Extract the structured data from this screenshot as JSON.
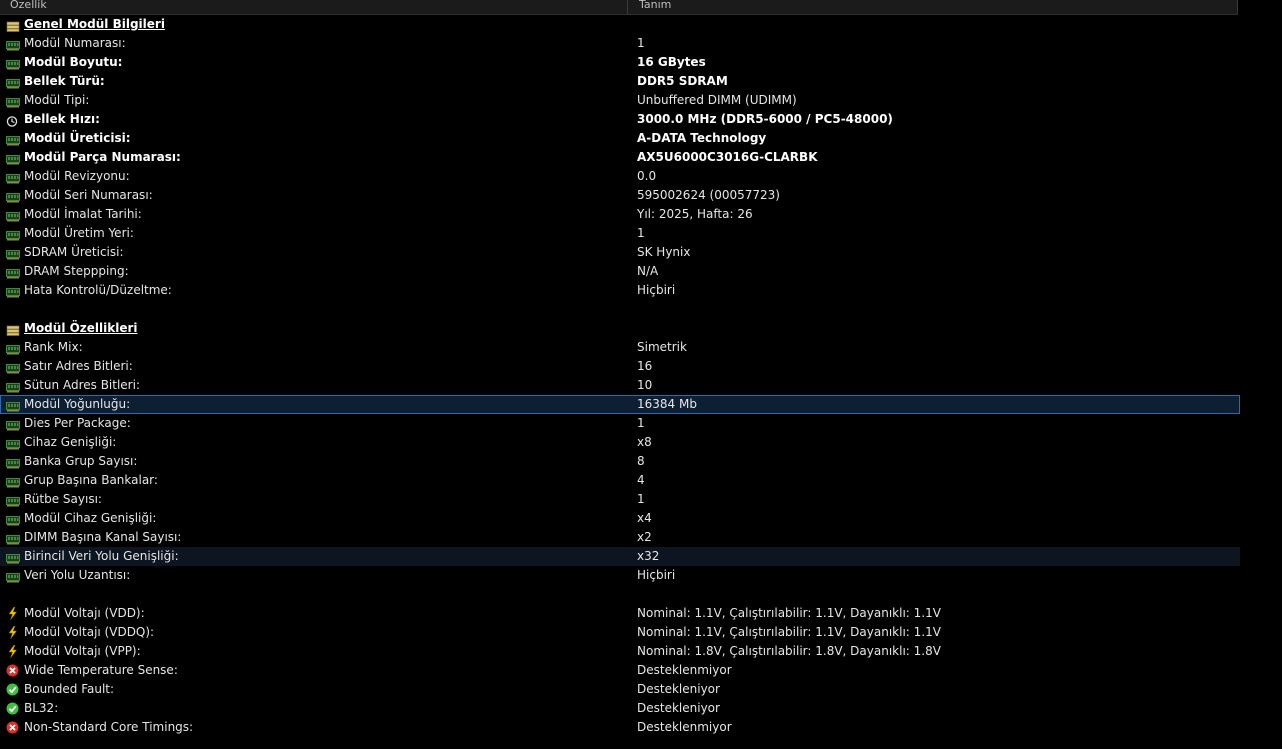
{
  "header": {
    "col_property": "Özellik",
    "col_value": "Tanım"
  },
  "rows": [
    {
      "type": "section",
      "icon": "memory-section-icon",
      "property": "Genel Modül Bilgileri",
      "value": ""
    },
    {
      "type": "item",
      "icon": "ram-module-icon",
      "property": "Modül Numarası:",
      "value": "1"
    },
    {
      "type": "item",
      "icon": "ram-module-icon",
      "property": "Modül Boyutu:",
      "value": "16 GBytes",
      "bold": true
    },
    {
      "type": "item",
      "icon": "ram-module-icon",
      "property": "Bellek Türü:",
      "value": "DDR5 SDRAM",
      "bold": true
    },
    {
      "type": "item",
      "icon": "ram-module-icon",
      "property": "Modül Tipi:",
      "value": "Unbuffered DIMM (UDIMM)"
    },
    {
      "type": "item",
      "icon": "clock-icon",
      "property": "Bellek Hızı:",
      "value": "3000.0 MHz (DDR5-6000 / PC5-48000)",
      "bold": true
    },
    {
      "type": "item",
      "icon": "ram-module-icon",
      "property": "Modül Üreticisi:",
      "value": "A-DATA Technology",
      "bold": true
    },
    {
      "type": "item",
      "icon": "ram-module-icon",
      "property": "Modül Parça Numarası:",
      "value": "AX5U6000C3016G-CLARBK",
      "bold": true
    },
    {
      "type": "item",
      "icon": "ram-module-icon",
      "property": "Modül Revizyonu:",
      "value": "0.0"
    },
    {
      "type": "item",
      "icon": "ram-module-icon",
      "property": "Modül Seri Numarası:",
      "value": "595002624 (00057723)"
    },
    {
      "type": "item",
      "icon": "ram-module-icon",
      "property": "Modül İmalat Tarihi:",
      "value": "Yıl: 2025, Hafta: 26"
    },
    {
      "type": "item",
      "icon": "ram-module-icon",
      "property": "Modül Üretim Yeri:",
      "value": "1"
    },
    {
      "type": "item",
      "icon": "ram-module-icon",
      "property": "SDRAM Üreticisi:",
      "value": "SK Hynix"
    },
    {
      "type": "item",
      "icon": "ram-module-icon",
      "property": "DRAM Steppping:",
      "value": "N/A"
    },
    {
      "type": "item",
      "icon": "ram-module-icon",
      "property": "Hata Kontrolü/Düzeltme:",
      "value": "Hiçbiri"
    },
    {
      "type": "blank"
    },
    {
      "type": "section",
      "icon": "memory-section-icon",
      "property": "Modül Özellikleri",
      "value": ""
    },
    {
      "type": "item",
      "icon": "ram-module-icon",
      "property": "Rank Mix:",
      "value": "Simetrik"
    },
    {
      "type": "item",
      "icon": "ram-module-icon",
      "property": "Satır Adres Bitleri:",
      "value": "16"
    },
    {
      "type": "item",
      "icon": "ram-module-icon",
      "property": "Sütun Adres Bitleri:",
      "value": "10"
    },
    {
      "type": "item",
      "icon": "ram-module-icon",
      "property": "Modül Yoğunluğu:",
      "value": "16384 Mb",
      "selected": true
    },
    {
      "type": "item",
      "icon": "ram-module-icon",
      "property": "Dies Per Package:",
      "value": "1"
    },
    {
      "type": "item",
      "icon": "ram-module-icon",
      "property": "Cihaz Genişliği:",
      "value": "x8"
    },
    {
      "type": "item",
      "icon": "ram-module-icon",
      "property": "Banka Grup Sayısı:",
      "value": "8"
    },
    {
      "type": "item",
      "icon": "ram-module-icon",
      "property": "Grup Başına Bankalar:",
      "value": "4"
    },
    {
      "type": "item",
      "icon": "ram-module-icon",
      "property": "Rütbe Sayısı:",
      "value": "1"
    },
    {
      "type": "item",
      "icon": "ram-module-icon",
      "property": "Modül Cihaz Genişliği:",
      "value": "x4"
    },
    {
      "type": "item",
      "icon": "ram-module-icon",
      "property": "DIMM Başına Kanal Sayısı:",
      "value": "x2"
    },
    {
      "type": "item",
      "icon": "ram-module-icon",
      "property": "Birincil Veri Yolu Genişliği:",
      "value": "x32",
      "hover": true
    },
    {
      "type": "item",
      "icon": "ram-module-icon",
      "property": "Veri Yolu Uzantısı:",
      "value": "Hiçbiri"
    },
    {
      "type": "blank"
    },
    {
      "type": "item",
      "icon": "lightning-icon",
      "property": "Modül Voltajı (VDD):",
      "value": "Nominal: 1.1V, Çalıştırılabilir: 1.1V, Dayanıklı: 1.1V"
    },
    {
      "type": "item",
      "icon": "lightning-icon",
      "property": "Modül Voltajı (VDDQ):",
      "value": "Nominal: 1.1V, Çalıştırılabilir: 1.1V, Dayanıklı: 1.1V"
    },
    {
      "type": "item",
      "icon": "lightning-icon",
      "property": "Modül Voltajı (VPP):",
      "value": "Nominal: 1.8V, Çalıştırılabilir: 1.8V, Dayanıklı: 1.8V"
    },
    {
      "type": "item",
      "icon": "red-x-icon",
      "property": "Wide Temperature Sense:",
      "value": "Desteklenmiyor"
    },
    {
      "type": "item",
      "icon": "green-check-icon",
      "property": "Bounded Fault:",
      "value": "Destekleniyor"
    },
    {
      "type": "item",
      "icon": "green-check-icon",
      "property": "BL32:",
      "value": "Destekleniyor"
    },
    {
      "type": "item",
      "icon": "red-x-icon",
      "property": "Non-Standard Core Timings:",
      "value": "Desteklenmiyor"
    }
  ],
  "colors": {
    "background": "#000000",
    "text": "#e6e6e6",
    "selected_border": "#2f6aa8",
    "selected_bg": "#0d1f33",
    "hover_bg": "#0c1520",
    "ram_icon_green": "#3f8a3f",
    "lightning_yellow": "#f2c200",
    "error_red": "#d9302c",
    "ok_green": "#3fbf3f"
  }
}
